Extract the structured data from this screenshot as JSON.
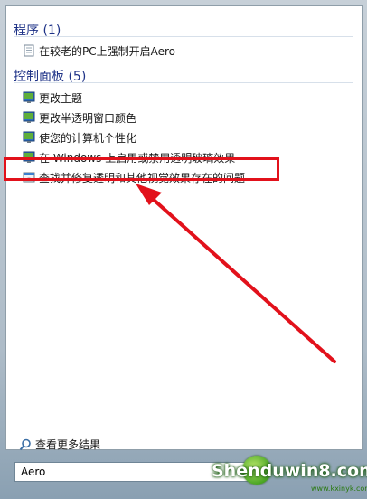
{
  "results": {
    "programs_header": "程序 (1)",
    "programs": [
      {
        "label": "在较老的PC上强制开启Aero",
        "icon": "document-icon"
      }
    ],
    "control_panel_header": "控制面板 (5)",
    "control_panel": [
      {
        "label": "更改主题",
        "icon": "control-panel-icon"
      },
      {
        "label": "更改半透明窗口颜色",
        "icon": "control-panel-icon"
      },
      {
        "label": "使您的计算机个性化",
        "icon": "control-panel-icon"
      },
      {
        "label": "在 Windows 上启用或禁用透明玻璃效果",
        "icon": "control-panel-icon"
      },
      {
        "label": "查找并修复透明和其他视觉效果存在的问题",
        "icon": "troubleshoot-icon"
      }
    ],
    "see_more_label": "查看更多结果"
  },
  "search": {
    "value": "Aero",
    "clear_glyph": "✕"
  },
  "annotation": {
    "highlight_color": "#e2111b"
  },
  "watermark": {
    "text": "Shenduwin8.com",
    "sub": "www.kxinyk.com"
  }
}
